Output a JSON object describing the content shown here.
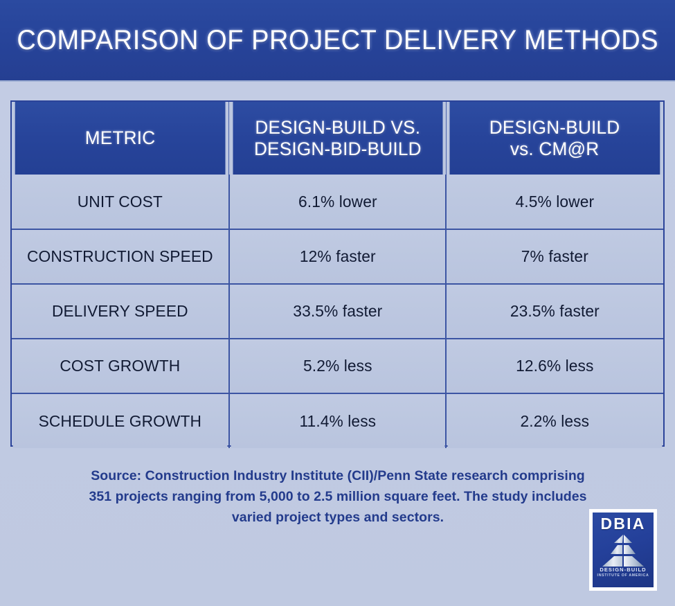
{
  "banner": {
    "title": "COMPARISON OF PROJECT DELIVERY METHODS"
  },
  "colors": {
    "banner_blue": "#27449A",
    "page_background": "#C2CBE3",
    "table_header_blue": "#27449A",
    "table_cell_blue": "#BCC7E0",
    "grid_line": "#3C55A3",
    "body_text": "#111A33",
    "source_text": "#233B8C",
    "header_text": "#FFFFFF"
  },
  "table": {
    "headers": [
      {
        "lines": [
          "METRIC"
        ]
      },
      {
        "lines": [
          "DESIGN-BUILD VS.",
          "DESIGN-BID-BUILD"
        ]
      },
      {
        "lines": [
          "DESIGN-BUILD",
          "vs. CM@R"
        ]
      }
    ],
    "rows": [
      {
        "metric": "UNIT COST",
        "db_vs_dbb": "6.1% lower",
        "db_vs_cmar": "4.5% lower"
      },
      {
        "metric": "CONSTRUCTION SPEED",
        "db_vs_dbb": "12% faster",
        "db_vs_cmar": "7% faster"
      },
      {
        "metric": "DELIVERY SPEED",
        "db_vs_dbb": "33.5% faster",
        "db_vs_cmar": "23.5% faster"
      },
      {
        "metric": "COST GROWTH",
        "db_vs_dbb": "5.2% less",
        "db_vs_cmar": "12.6% less"
      },
      {
        "metric": "SCHEDULE GROWTH",
        "db_vs_dbb": "11.4% less",
        "db_vs_cmar": "2.2% less"
      }
    ]
  },
  "source": {
    "line1": "Source: Construction Industry Institute (CII)/Penn State research comprising",
    "line2": "351 projects ranging from 5,000 to 2.5 million square feet. The study includes",
    "line3": "varied project types and sectors."
  },
  "logo": {
    "wordmark": "DBIA",
    "sub_line1": "DESIGN-BUILD",
    "sub_line2": "INSTITUTE OF AMERICA",
    "icon": "dbia-pyramid-icon"
  },
  "chart_data": {
    "type": "table",
    "title": "COMPARISON OF PROJECT DELIVERY METHODS",
    "columns": [
      "METRIC",
      "DESIGN-BUILD VS. DESIGN-BID-BUILD",
      "DESIGN-BUILD vs. CM@R"
    ],
    "rows": [
      [
        "UNIT COST",
        "6.1% lower",
        "4.5% lower"
      ],
      [
        "CONSTRUCTION SPEED",
        "12% faster",
        "7% faster"
      ],
      [
        "DELIVERY SPEED",
        "33.5% faster",
        "23.5% faster"
      ],
      [
        "COST GROWTH",
        "5.2% less",
        "12.6% less"
      ],
      [
        "SCHEDULE GROWTH",
        "11.4% less",
        "2.2% less"
      ]
    ],
    "series": [
      {
        "name": "DESIGN-BUILD VS. DESIGN-BID-BUILD",
        "categories": [
          "UNIT COST",
          "CONSTRUCTION SPEED",
          "DELIVERY SPEED",
          "COST GROWTH",
          "SCHEDULE GROWTH"
        ],
        "values": [
          6.1,
          12,
          33.5,
          5.2,
          11.4
        ],
        "units": "percent",
        "directions": [
          "lower",
          "faster",
          "faster",
          "less",
          "less"
        ]
      },
      {
        "name": "DESIGN-BUILD vs. CM@R",
        "categories": [
          "UNIT COST",
          "CONSTRUCTION SPEED",
          "DELIVERY SPEED",
          "COST GROWTH",
          "SCHEDULE GROWTH"
        ],
        "values": [
          4.5,
          7,
          23.5,
          12.6,
          2.2
        ],
        "units": "percent",
        "directions": [
          "lower",
          "faster",
          "faster",
          "less",
          "less"
        ]
      }
    ],
    "annotations": [
      "Source: Construction Industry Institute (CII)/Penn State research comprising 351 projects ranging from 5,000 to 2.5 million square feet. The study includes varied project types and sectors."
    ]
  }
}
